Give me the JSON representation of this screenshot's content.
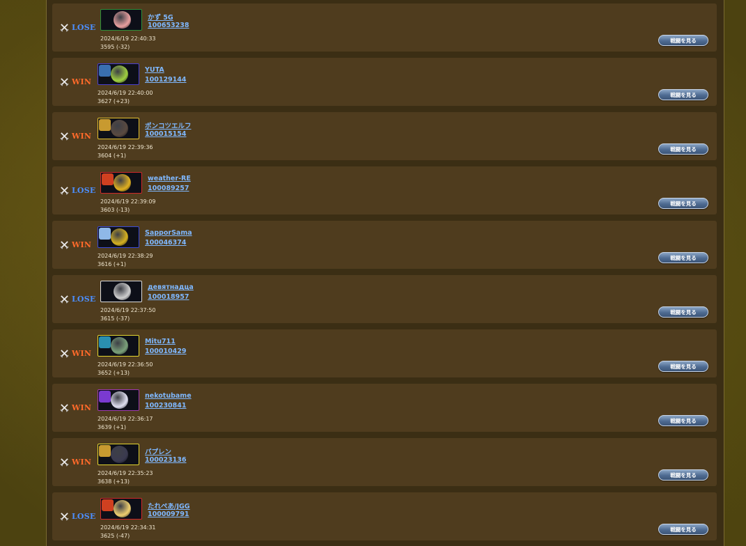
{
  "battles": [
    {
      "result": "LOSE",
      "name": "かず 5G",
      "id": "100653238",
      "time": "2024/6/19 22:40:33",
      "rating": "3595 (-32)",
      "button": "戦闘を見る",
      "frame": "#2d8f3a",
      "face": "#e9a0a0",
      "badge": ""
    },
    {
      "result": "WIN",
      "name": "YUTA",
      "id": "100129144",
      "time": "2024/6/19 22:40:00",
      "rating": "3627 (+23)",
      "button": "戦闘を見る",
      "frame": "#4a3fd0",
      "face": "#9fd040",
      "badge": "#3a6fb0"
    },
    {
      "result": "WIN",
      "name": "ポンコツエルフ",
      "id": "100015154",
      "time": "2024/6/19 22:39:36",
      "rating": "3604 (+1)",
      "button": "戦闘を見る",
      "frame": "#e6c230",
      "face": "#5a4a40",
      "badge": "#c89a30"
    },
    {
      "result": "LOSE",
      "name": "weather-RE",
      "id": "100089257",
      "time": "2024/6/19 22:39:09",
      "rating": "3603 (-13)",
      "button": "戦闘を見る",
      "frame": "#d02a2a",
      "face": "#e0b020",
      "badge": "#d04020"
    },
    {
      "result": "WIN",
      "name": "SapporSama",
      "id": "100046374",
      "time": "2024/6/19 22:38:29",
      "rating": "3616 (+1)",
      "button": "戦闘を見る",
      "frame": "#3a4ad8",
      "face": "#d4b020",
      "badge": "#8fb8e8"
    },
    {
      "result": "LOSE",
      "name": "девятнадца",
      "id": "100018957",
      "time": "2024/6/19 22:37:50",
      "rating": "3615 (-37)",
      "button": "戦闘を見る",
      "frame": "#dddddd",
      "face": "#cfcfcf",
      "badge": ""
    },
    {
      "result": "WIN",
      "name": "Mitu711",
      "id": "100010429",
      "time": "2024/6/19 22:36:50",
      "rating": "3652 (+13)",
      "button": "戦闘を見る",
      "frame": "#e6d830",
      "face": "#7aa07a",
      "badge": "#2a8fb0"
    },
    {
      "result": "WIN",
      "name": "nekotubame",
      "id": "100230841",
      "time": "2024/6/19 22:36:17",
      "rating": "3639 (+1)",
      "button": "戦闘を見る",
      "frame": "#a03ab0",
      "face": "#e0e0f0",
      "badge": "#7a3ad0"
    },
    {
      "result": "WIN",
      "name": "パプレン",
      "id": "100023136",
      "time": "2024/6/19 22:35:23",
      "rating": "3638 (+13)",
      "button": "戦闘を見る",
      "frame": "#e6d830",
      "face": "#3a3a50",
      "badge": "#c89a30"
    },
    {
      "result": "LOSE",
      "name": "たれぺあ/JGG",
      "id": "100009791",
      "time": "2024/6/19 22:34:31",
      "rating": "3625 (-47)",
      "button": "戦闘を見る",
      "frame": "#d02a2a",
      "face": "#f0d070",
      "badge": "#d04020"
    }
  ]
}
